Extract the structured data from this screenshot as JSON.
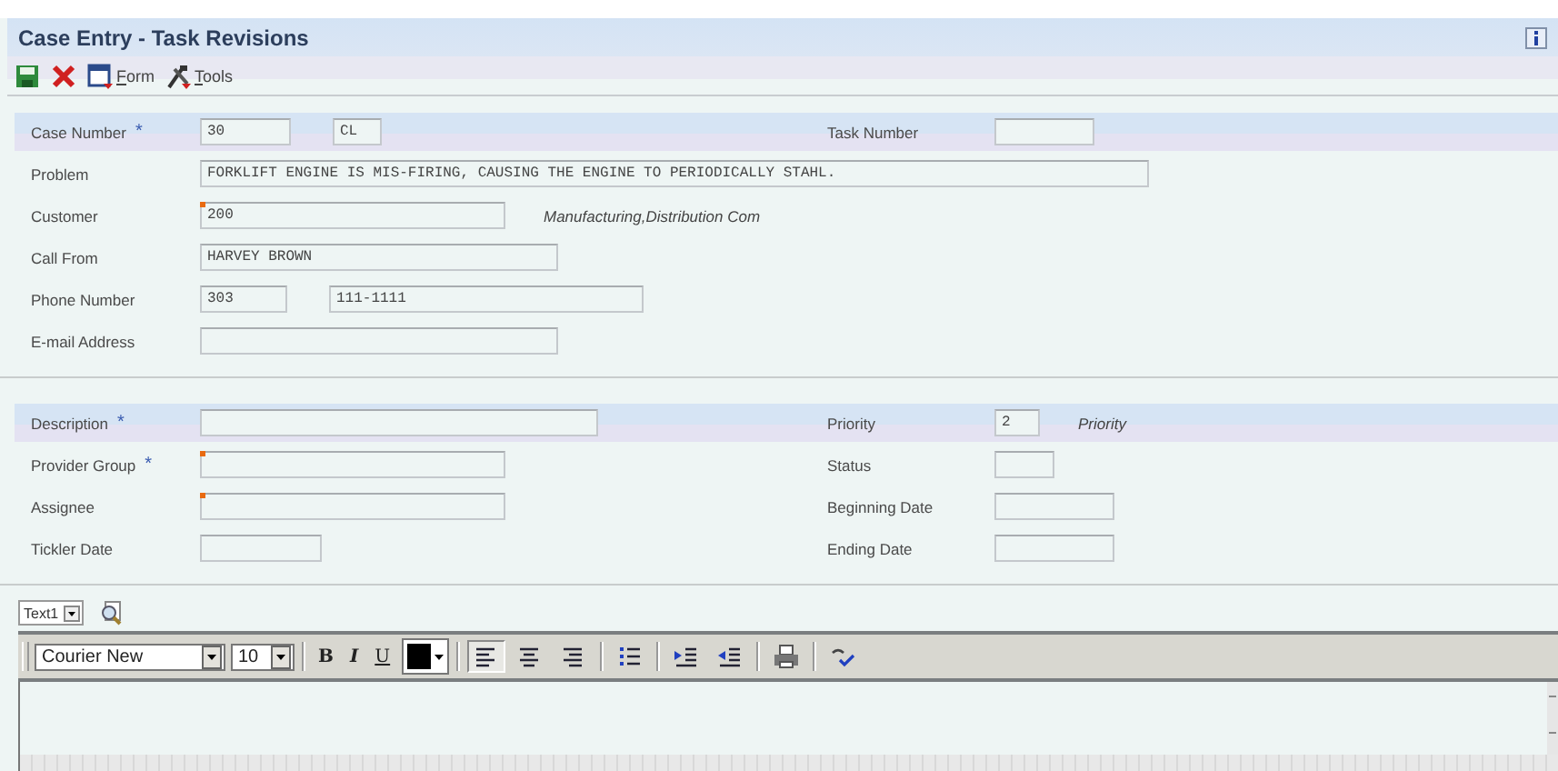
{
  "window": {
    "title": "Case Entry - Task Revisions"
  },
  "toolbar": [
    {
      "kind": "save"
    },
    {
      "kind": "close"
    },
    {
      "kind": "form",
      "label": "Form"
    },
    {
      "kind": "tools",
      "label": "Tools"
    }
  ],
  "sections": [
    {
      "rows": [
        {
          "band": true,
          "label": "Case Number",
          "required": "*",
          "fields": [
            {
              "value": "30",
              "flagged": false
            },
            {
              "value": "CL",
              "flagged": false
            }
          ],
          "right": {
            "label": "Task Number",
            "fields": [
              {
                "flagged": false
              }
            ]
          }
        },
        {
          "band": false,
          "label": "Problem",
          "fields": [
            {
              "value": "FORKLIFT ENGINE IS MIS-FIRING, CAUSING THE ENGINE TO PERIODICALLY STAHL.",
              "flagged": false
            }
          ]
        },
        {
          "band": false,
          "label": "Customer",
          "fields": [
            {
              "value": "200",
              "flagged": true
            }
          ],
          "note": "Manufacturing,Distribution Com"
        },
        {
          "band": false,
          "label": "Call From",
          "fields": [
            {
              "value": "HARVEY BROWN",
              "flagged": false
            }
          ]
        },
        {
          "band": false,
          "label": "Phone Number",
          "fields": [
            {
              "value": "303",
              "flagged": false
            },
            {
              "value": "111-1111",
              "flagged": false
            }
          ]
        },
        {
          "band": false,
          "label": "E-mail Address",
          "fields": [
            {
              "flagged": false
            }
          ]
        }
      ]
    },
    {
      "rows": [
        {
          "band": true,
          "label": "Description",
          "required": "*",
          "fields": [
            {
              "flagged": false
            }
          ],
          "right": {
            "label": "Priority",
            "fields": [
              {
                "value": "2",
                "flagged": false
              }
            ],
            "note": "Priority"
          }
        },
        {
          "band": false,
          "label": "Provider Group",
          "required": "*",
          "fields": [
            {
              "flagged": true
            }
          ],
          "right": {
            "label": "Status",
            "fields": [
              {
                "flagged": false
              }
            ]
          }
        },
        {
          "band": false,
          "label": "Assignee",
          "fields": [
            {
              "flagged": true
            }
          ],
          "right": {
            "label": "Beginning Date",
            "fields": [
              {
                "flagged": false
              }
            ]
          }
        },
        {
          "band": false,
          "label": "Tickler Date",
          "fields": [
            {
              "flagged": false
            }
          ],
          "right": {
            "label": "Ending Date",
            "fields": [
              {
                "flagged": false
              }
            ]
          }
        }
      ]
    }
  ],
  "editor": {
    "text_select": "Text1",
    "tools": [
      {
        "kind": "font-select",
        "value": "Courier New"
      },
      {
        "kind": "size-select",
        "value": "10"
      },
      {
        "kind": "sep"
      },
      {
        "kind": "bold",
        "label": "B"
      },
      {
        "kind": "italic",
        "label": "I"
      },
      {
        "kind": "underline",
        "label": "U"
      },
      {
        "kind": "color",
        "color": "#000000"
      },
      {
        "kind": "sep"
      },
      {
        "kind": "align-left",
        "pressed": true
      },
      {
        "kind": "align-center",
        "pressed": false
      },
      {
        "kind": "align-right",
        "pressed": false
      },
      {
        "kind": "sep"
      },
      {
        "kind": "bullets"
      },
      {
        "kind": "sep"
      },
      {
        "kind": "indent"
      },
      {
        "kind": "outdent"
      },
      {
        "kind": "sep"
      },
      {
        "kind": "print"
      },
      {
        "kind": "sep"
      },
      {
        "kind": "spell"
      }
    ]
  }
}
